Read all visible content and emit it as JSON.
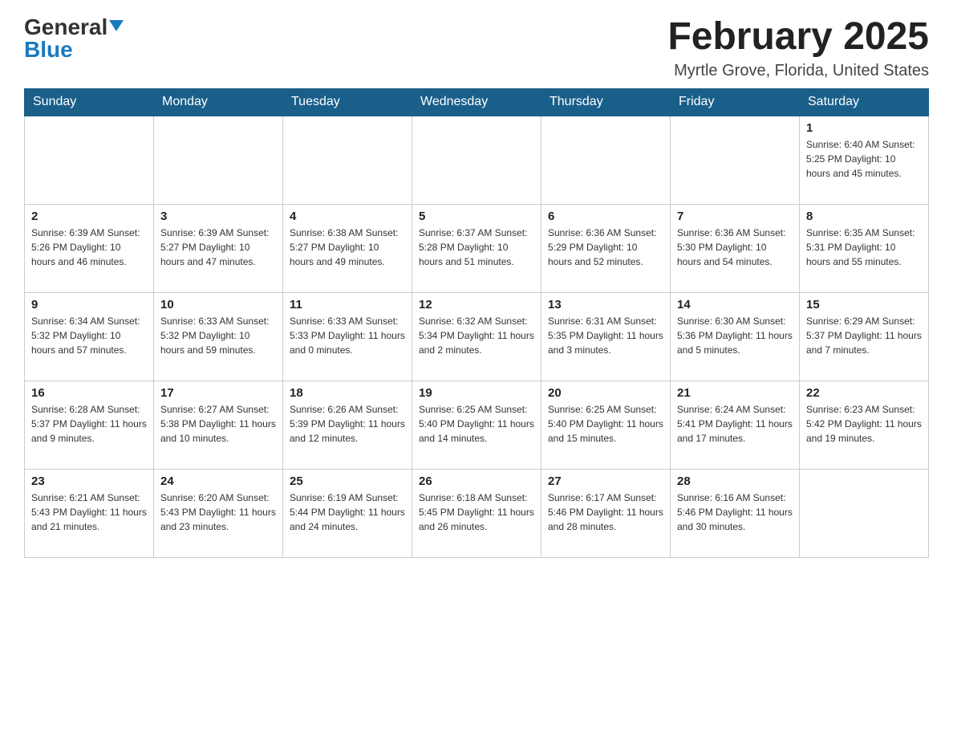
{
  "header": {
    "logo_general": "General",
    "logo_blue": "Blue",
    "month_title": "February 2025",
    "location": "Myrtle Grove, Florida, United States"
  },
  "weekdays": [
    "Sunday",
    "Monday",
    "Tuesday",
    "Wednesday",
    "Thursday",
    "Friday",
    "Saturday"
  ],
  "weeks": [
    [
      {
        "day": "",
        "info": ""
      },
      {
        "day": "",
        "info": ""
      },
      {
        "day": "",
        "info": ""
      },
      {
        "day": "",
        "info": ""
      },
      {
        "day": "",
        "info": ""
      },
      {
        "day": "",
        "info": ""
      },
      {
        "day": "1",
        "info": "Sunrise: 6:40 AM\nSunset: 5:25 PM\nDaylight: 10 hours and 45 minutes."
      }
    ],
    [
      {
        "day": "2",
        "info": "Sunrise: 6:39 AM\nSunset: 5:26 PM\nDaylight: 10 hours and 46 minutes."
      },
      {
        "day": "3",
        "info": "Sunrise: 6:39 AM\nSunset: 5:27 PM\nDaylight: 10 hours and 47 minutes."
      },
      {
        "day": "4",
        "info": "Sunrise: 6:38 AM\nSunset: 5:27 PM\nDaylight: 10 hours and 49 minutes."
      },
      {
        "day": "5",
        "info": "Sunrise: 6:37 AM\nSunset: 5:28 PM\nDaylight: 10 hours and 51 minutes."
      },
      {
        "day": "6",
        "info": "Sunrise: 6:36 AM\nSunset: 5:29 PM\nDaylight: 10 hours and 52 minutes."
      },
      {
        "day": "7",
        "info": "Sunrise: 6:36 AM\nSunset: 5:30 PM\nDaylight: 10 hours and 54 minutes."
      },
      {
        "day": "8",
        "info": "Sunrise: 6:35 AM\nSunset: 5:31 PM\nDaylight: 10 hours and 55 minutes."
      }
    ],
    [
      {
        "day": "9",
        "info": "Sunrise: 6:34 AM\nSunset: 5:32 PM\nDaylight: 10 hours and 57 minutes."
      },
      {
        "day": "10",
        "info": "Sunrise: 6:33 AM\nSunset: 5:32 PM\nDaylight: 10 hours and 59 minutes."
      },
      {
        "day": "11",
        "info": "Sunrise: 6:33 AM\nSunset: 5:33 PM\nDaylight: 11 hours and 0 minutes."
      },
      {
        "day": "12",
        "info": "Sunrise: 6:32 AM\nSunset: 5:34 PM\nDaylight: 11 hours and 2 minutes."
      },
      {
        "day": "13",
        "info": "Sunrise: 6:31 AM\nSunset: 5:35 PM\nDaylight: 11 hours and 3 minutes."
      },
      {
        "day": "14",
        "info": "Sunrise: 6:30 AM\nSunset: 5:36 PM\nDaylight: 11 hours and 5 minutes."
      },
      {
        "day": "15",
        "info": "Sunrise: 6:29 AM\nSunset: 5:37 PM\nDaylight: 11 hours and 7 minutes."
      }
    ],
    [
      {
        "day": "16",
        "info": "Sunrise: 6:28 AM\nSunset: 5:37 PM\nDaylight: 11 hours and 9 minutes."
      },
      {
        "day": "17",
        "info": "Sunrise: 6:27 AM\nSunset: 5:38 PM\nDaylight: 11 hours and 10 minutes."
      },
      {
        "day": "18",
        "info": "Sunrise: 6:26 AM\nSunset: 5:39 PM\nDaylight: 11 hours and 12 minutes."
      },
      {
        "day": "19",
        "info": "Sunrise: 6:25 AM\nSunset: 5:40 PM\nDaylight: 11 hours and 14 minutes."
      },
      {
        "day": "20",
        "info": "Sunrise: 6:25 AM\nSunset: 5:40 PM\nDaylight: 11 hours and 15 minutes."
      },
      {
        "day": "21",
        "info": "Sunrise: 6:24 AM\nSunset: 5:41 PM\nDaylight: 11 hours and 17 minutes."
      },
      {
        "day": "22",
        "info": "Sunrise: 6:23 AM\nSunset: 5:42 PM\nDaylight: 11 hours and 19 minutes."
      }
    ],
    [
      {
        "day": "23",
        "info": "Sunrise: 6:21 AM\nSunset: 5:43 PM\nDaylight: 11 hours and 21 minutes."
      },
      {
        "day": "24",
        "info": "Sunrise: 6:20 AM\nSunset: 5:43 PM\nDaylight: 11 hours and 23 minutes."
      },
      {
        "day": "25",
        "info": "Sunrise: 6:19 AM\nSunset: 5:44 PM\nDaylight: 11 hours and 24 minutes."
      },
      {
        "day": "26",
        "info": "Sunrise: 6:18 AM\nSunset: 5:45 PM\nDaylight: 11 hours and 26 minutes."
      },
      {
        "day": "27",
        "info": "Sunrise: 6:17 AM\nSunset: 5:46 PM\nDaylight: 11 hours and 28 minutes."
      },
      {
        "day": "28",
        "info": "Sunrise: 6:16 AM\nSunset: 5:46 PM\nDaylight: 11 hours and 30 minutes."
      },
      {
        "day": "",
        "info": ""
      }
    ]
  ]
}
